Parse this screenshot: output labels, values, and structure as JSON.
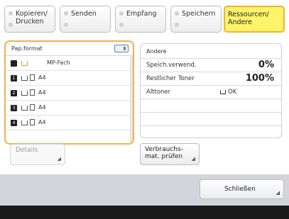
{
  "tabs": [
    {
      "label": "Kopieren/\nDrucken",
      "active": false
    },
    {
      "label": "Senden",
      "active": false
    },
    {
      "label": "Empfang",
      "active": false
    },
    {
      "label": "Speichern",
      "active": false
    },
    {
      "label": "Ressourcen/\nAndere",
      "active": true
    }
  ],
  "paper_panel": {
    "header": "Pap.format",
    "rows": [
      {
        "slot": "MP",
        "label": "MP-Fach",
        "icon": "mp-tray-icon"
      },
      {
        "slot": "1",
        "label": "A4",
        "icon": "tray-icon"
      },
      {
        "slot": "2",
        "label": "A4",
        "icon": "tray-icon"
      },
      {
        "slot": "3",
        "label": "A4",
        "icon": "tray-icon"
      },
      {
        "slot": "4",
        "label": "A4",
        "icon": "tray-icon"
      }
    ]
  },
  "other_panel": {
    "title": "Andere",
    "rows": [
      {
        "key": "Speich.verwend.",
        "value": "0%"
      },
      {
        "key": "Restlicher Toner",
        "value": "100%"
      },
      {
        "key": "Alttoner",
        "value": "OK"
      }
    ]
  },
  "buttons": {
    "details": "Details",
    "consumables": "Verbrauchs-\nmat. prüfen",
    "close": "Schließen"
  },
  "colors": {
    "active_tab": "#fff46a",
    "highlight_border": "#f2b04a",
    "footer": "#d2d5db"
  }
}
